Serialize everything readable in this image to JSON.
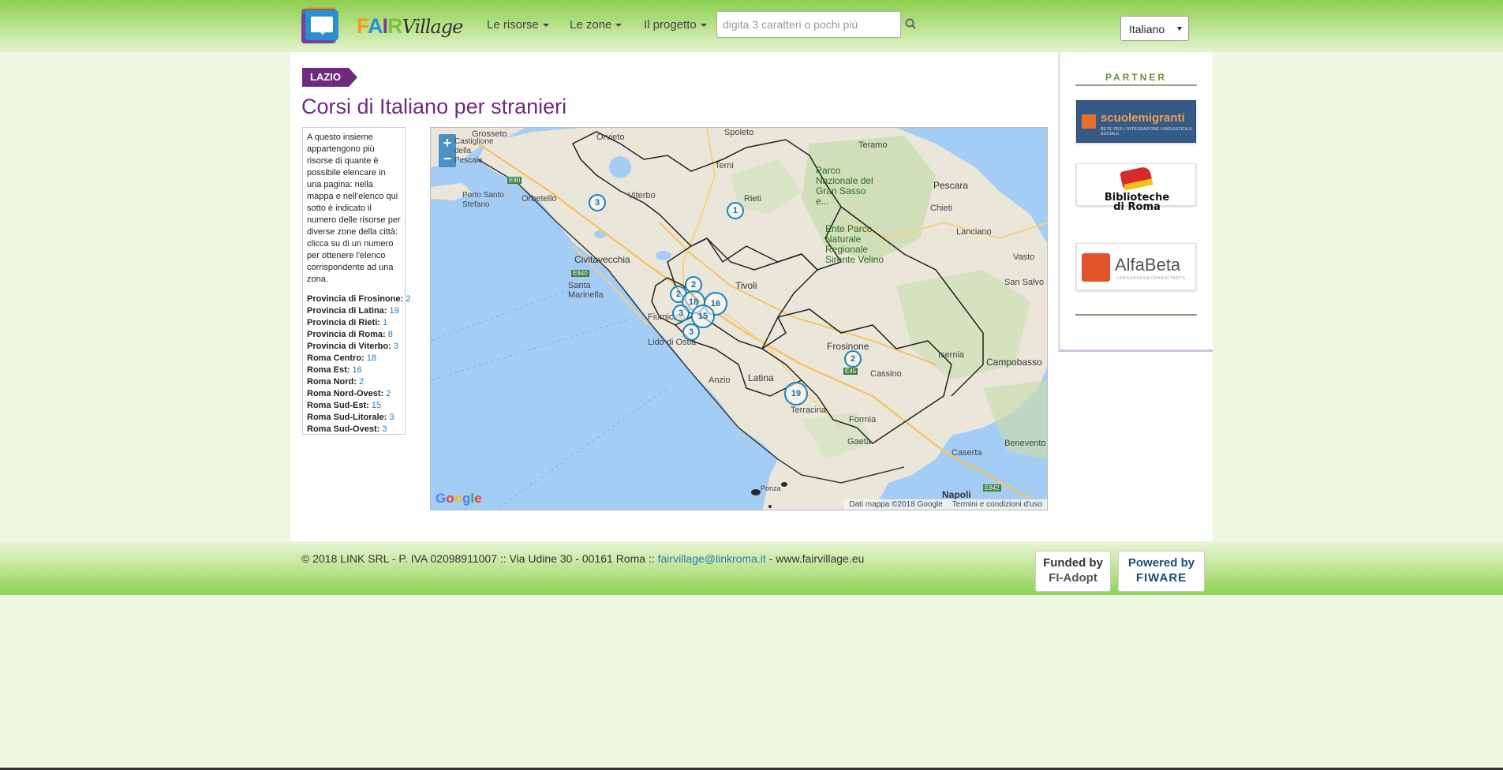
{
  "header": {
    "logo_text": {
      "f": "F",
      "a": "A",
      "i": "I",
      "r": "R",
      "v": "Village"
    },
    "nav": [
      {
        "label": "Le risorse"
      },
      {
        "label": "Le zone"
      },
      {
        "label": "Il progetto"
      }
    ],
    "search": {
      "placeholder": "digita 3 caratteri o pochi più",
      "value": "",
      "icon": "search-icon"
    },
    "language": {
      "selected": "Italiano"
    }
  },
  "page": {
    "region_tag": "LAZIO",
    "title": "Corsi di Italiano per stranieri",
    "intro": "A questo insieme appartengono più risorse di quante è possibile elencare in una pagina: nella mappa e nell'elenco qui sotto è indicato il numero delle risorse per diverse zone della città: clicca su di un numero per ottenere l'elenco corrispondente ad una zona.",
    "zones": [
      {
        "name": "Provincia di Frosinone:",
        "count": "2"
      },
      {
        "name": "Provincia di Latina:",
        "count": "19"
      },
      {
        "name": "Provincia di Rieti:",
        "count": "1"
      },
      {
        "name": "Provincia di Roma:",
        "count": "8"
      },
      {
        "name": "Provincia di Viterbo:",
        "count": "3"
      },
      {
        "name": "Roma Centro:",
        "count": "18"
      },
      {
        "name": "Roma Est:",
        "count": "16"
      },
      {
        "name": "Roma Nord:",
        "count": "2"
      },
      {
        "name": "Roma Nord-Ovest:",
        "count": "2"
      },
      {
        "name": "Roma Sud-Est:",
        "count": "15"
      },
      {
        "name": "Roma Sud-Litorale:",
        "count": "3"
      },
      {
        "name": "Roma Sud-Ovest:",
        "count": "3"
      }
    ]
  },
  "map": {
    "zoom_in": "+",
    "zoom_out": "−",
    "markers": [
      "3",
      "1",
      "2",
      "2",
      "18",
      "16",
      "3",
      "15",
      "3",
      "2",
      "19"
    ],
    "places": [
      "Grosseto",
      "Orvieto",
      "Spoleto",
      "Teramo",
      "Castiglione della Pescaia",
      "Viterbo",
      "Terni",
      "Rieti",
      "Pescara",
      "Porto Santo Stefano",
      "Orbetello",
      "Chieti",
      "Lanciano",
      "Civitavecchia",
      "Vasto",
      "Santa Marinella",
      "Tivoli",
      "San Salvo",
      "Fiumicino",
      "Lido di Ostia",
      "Frosinone",
      "Isernia",
      "Campobasso",
      "Cassino",
      "Anzio",
      "Latina",
      "Terracina",
      "Formia",
      "Benevento",
      "Gaeta",
      "Caserta",
      "Napoli",
      "Ponza"
    ],
    "park_labels": [
      "Parco Nazionale del Gran Sasso e...",
      "Ente Parco Naturale Regionale Sirente Velino"
    ],
    "road_labels": [
      "E80",
      "E840",
      "E45",
      "E842"
    ],
    "google_letters": [
      "G",
      "o",
      "o",
      "g",
      "l",
      "e"
    ],
    "attribution": "Dati mappa ©2018 Google",
    "terms": "Termini e condizioni d'uso"
  },
  "partner": {
    "title": "PARTNER",
    "scuolemigranti": {
      "name": "scuolemigranti",
      "subtitle": "RETE PER L'INTEGRAZIONE LINGUISTICA E SOCIALE"
    },
    "biblioteche": {
      "line1": "Biblioteche",
      "line2": "di Roma"
    },
    "alfabeta": {
      "name": "AlfaBeta",
      "subtitle": "LANGUAGES&CONSULTANTS"
    }
  },
  "footer": {
    "copyright": "© 2018 LINK SRL - P. IVA 02098911007 :: Via Udine 30 - 00161 Roma ::",
    "email": "fairvillage@linkroma.it",
    "site": "- www.fairvillage.eu",
    "funded": {
      "line1": "Funded by",
      "line2": "FI-Adopt"
    },
    "powered": {
      "line1": "Powered by",
      "line2": "FIWARE"
    }
  },
  "colors": {
    "accent": "#6f2a7e",
    "link": "#2a7ab8",
    "header_green": "#8ccf4e",
    "map_water": "#a4cdf6"
  }
}
